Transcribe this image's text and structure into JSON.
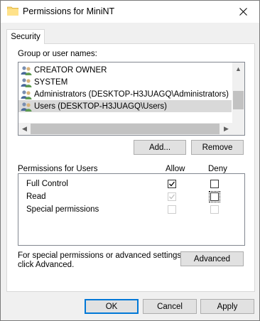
{
  "window": {
    "title": "Permissions for MiniNT"
  },
  "tabs": [
    {
      "label": "Security"
    }
  ],
  "group_section": {
    "label": "Group or user names:",
    "users": [
      {
        "name": "CREATOR OWNER"
      },
      {
        "name": "SYSTEM"
      },
      {
        "name": "Administrators (DESKTOP-H3JUAGQ\\Administrators)"
      },
      {
        "name": "Users (DESKTOP-H3JUAGQ\\Users)"
      }
    ],
    "selected_user": "Users (DESKTOP-H3JUAGQ\\Users)",
    "add_button": "Add...",
    "remove_button": "Remove"
  },
  "permissions": {
    "label": "Permissions for Users",
    "allow_header": "Allow",
    "deny_header": "Deny",
    "rows": [
      {
        "name": "Full Control",
        "allow": true,
        "allow_enabled": true,
        "deny": false,
        "deny_enabled": true
      },
      {
        "name": "Read",
        "allow": true,
        "allow_enabled": false,
        "deny": false,
        "deny_enabled": true
      },
      {
        "name": "Special permissions",
        "allow": false,
        "allow_enabled": false,
        "deny": false,
        "deny_enabled": false
      }
    ]
  },
  "advanced": {
    "text_line1": "For special permissions or advanced settings,",
    "text_line2": "click Advanced.",
    "button": "Advanced"
  },
  "footer": {
    "ok": "OK",
    "cancel": "Cancel",
    "apply": "Apply"
  }
}
